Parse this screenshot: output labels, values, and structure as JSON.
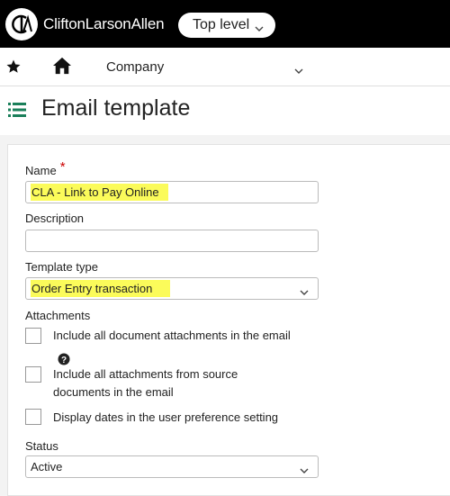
{
  "topbar": {
    "brand": "CliftonLarsonAllen",
    "logo_text": "CLA",
    "level": "Top level"
  },
  "nav": {
    "company": "Company"
  },
  "header": {
    "title": "Email template"
  },
  "form": {
    "name_label": "Name",
    "name_required": "*",
    "name_value": "CLA - Link to Pay Online",
    "description_label": "Description",
    "description_value": "",
    "template_type_label": "Template type",
    "template_type_value": "Order Entry transaction",
    "attachments_label": "Attachments",
    "include_all_docs": "Include all document attachments in the email",
    "include_source_line1": "Include all attachments from source",
    "include_source_line2": "documents in the email",
    "display_dates": "Display dates in the user preference setting",
    "status_label": "Status",
    "status_value": "Active"
  },
  "colors": {
    "highlight": "#fbfb5a",
    "required": "#cc0000",
    "topbar": "#000000"
  }
}
